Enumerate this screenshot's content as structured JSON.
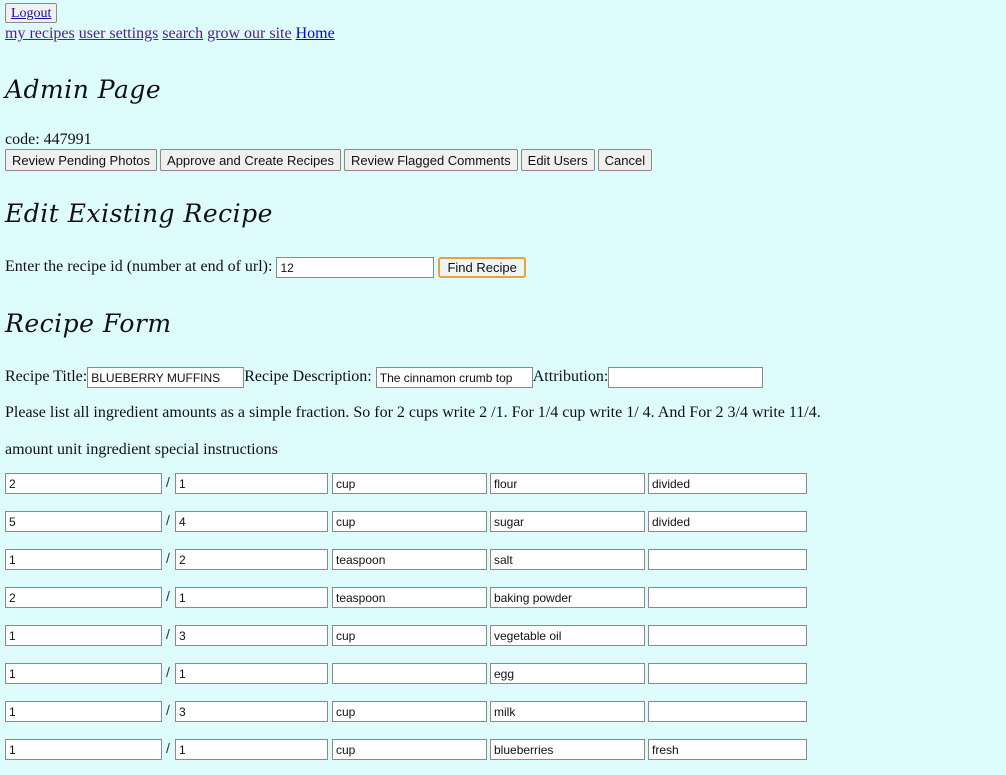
{
  "header": {
    "logout_label": "Logout",
    "nav": {
      "my_recipes": "my recipes",
      "user_settings": "user settings",
      "search": "search",
      "grow_our_site": "grow our site",
      "home": "Home"
    }
  },
  "admin": {
    "title": "Admin Page",
    "code": "code: 447991",
    "buttons": {
      "review_photos": "Review Pending Photos",
      "approve_create": "Approve and Create Recipes",
      "review_comments": "Review Flagged Comments",
      "edit_users": "Edit Users",
      "cancel": "Cancel"
    }
  },
  "edit": {
    "title": "Edit Existing Recipe",
    "prompt": "Enter the recipe id (number at end of url):",
    "recipe_id": "12",
    "find_label": "Find Recipe"
  },
  "form": {
    "title": "Recipe Form",
    "recipe_title_label": "Recipe Title:",
    "recipe_title_value": "BLUEBERRY MUFFINS",
    "description_label": "Recipe Description:",
    "description_value": "The cinnamon crumb top",
    "attribution_label": "Attribution:",
    "attribution_value": "",
    "instructions": "Please list all ingredient amounts as a simple fraction. So for 2 cups write 2 /1. For 1/4 cup write 1/ 4. And For 2 3/4 write 11/4.",
    "columns_text": "amount unit ingredient special instructions",
    "slash": "/",
    "ingredients": [
      {
        "num": "2",
        "den": "1",
        "unit": "cup",
        "ingredient": "flour",
        "special": "divided"
      },
      {
        "num": "5",
        "den": "4",
        "unit": "cup",
        "ingredient": "sugar",
        "special": "divided"
      },
      {
        "num": "1",
        "den": "2",
        "unit": "teaspoon",
        "ingredient": "salt",
        "special": ""
      },
      {
        "num": "2",
        "den": "1",
        "unit": "teaspoon",
        "ingredient": "baking powder",
        "special": ""
      },
      {
        "num": "1",
        "den": "3",
        "unit": "cup",
        "ingredient": "vegetable oil",
        "special": ""
      },
      {
        "num": "1",
        "den": "1",
        "unit": "",
        "ingredient": "egg",
        "special": ""
      },
      {
        "num": "1",
        "den": "3",
        "unit": "cup",
        "ingredient": "milk",
        "special": ""
      },
      {
        "num": "1",
        "den": "1",
        "unit": "cup",
        "ingredient": "blueberries",
        "special": "fresh"
      }
    ]
  },
  "colors": {
    "background": "#dffcfd",
    "find_button_border": "#e8a33d",
    "link_visited": "#551a8b",
    "link": "#0000ee"
  }
}
